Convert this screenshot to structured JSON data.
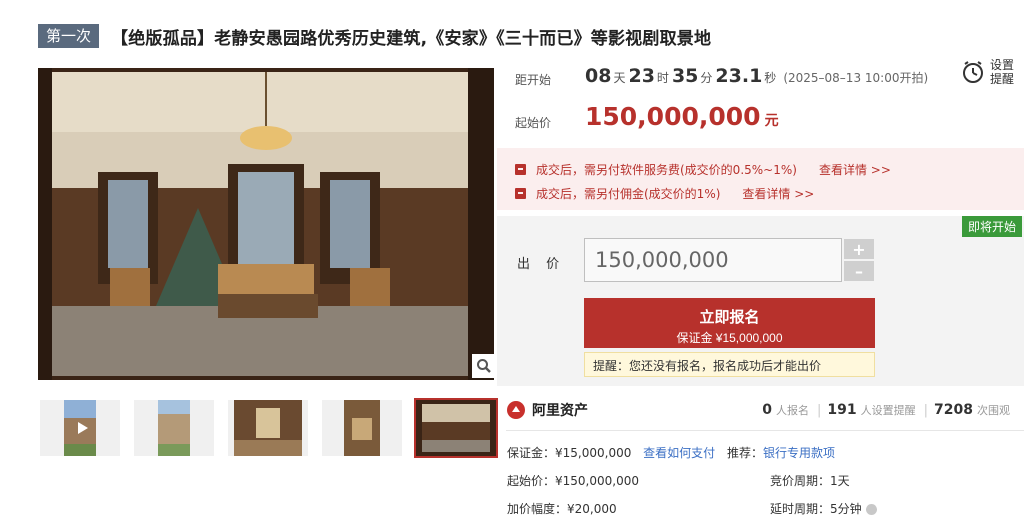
{
  "title": {
    "round_badge": "第一次",
    "text": "【绝版孤品】老静安愚园路优秀历史建筑,《安家》《三十而已》等影视剧取景地"
  },
  "countdown": {
    "label": "距开始",
    "days": "08",
    "days_unit": "天",
    "hours": "23",
    "hours_unit": "时",
    "minutes": "35",
    "minutes_unit": "分",
    "seconds": "23.1",
    "seconds_unit": "秒",
    "start_note": "(2025–08–13 10:00开拍)"
  },
  "reminder": {
    "line1": "设置",
    "line2": "提醒",
    "icon": "alarm-clock-icon"
  },
  "start_price": {
    "label": "起始价",
    "value": "150,000,000",
    "unit": "元"
  },
  "notices": [
    {
      "text": "成交后，需另付软件服务费(成交价的0.5%~1%)",
      "link": "查看详情 >>"
    },
    {
      "text": "成交后，需另付佣金(成交价的1%)",
      "link": "查看详情 >>"
    }
  ],
  "bid": {
    "status_tag": "即将开始",
    "label": "出 价",
    "input_value": "150,000,000",
    "plus": "+",
    "minus": "–",
    "register_label": "立即报名",
    "deposit_note": "保证金 ¥15,000,000",
    "tip": "提醒：您还没有报名，报名成功后才能出价"
  },
  "org": {
    "name": "阿里资产",
    "icon": "ali-asset-logo-icon"
  },
  "stats": [
    {
      "num": "0",
      "label": "人报名"
    },
    {
      "num": "191",
      "label": "人设置提醒"
    },
    {
      "num": "7208",
      "label": "次围观"
    }
  ],
  "details": {
    "deposit": "保证金：¥15,000,000",
    "how_to_pay": "查看如何支付",
    "recommend_label": "推荐：",
    "recommend_link": "银行专用款项",
    "start_price": "起始价：¥150,000,000",
    "cycle": "竞价周期：1天",
    "increment": "加价幅度：¥20,000",
    "delay": "延时周期：5分钟"
  },
  "colors": {
    "accent": "#b7312c",
    "badge": "#5a6a7e",
    "soon": "#3a9a3a",
    "link": "#3b6fc4"
  }
}
